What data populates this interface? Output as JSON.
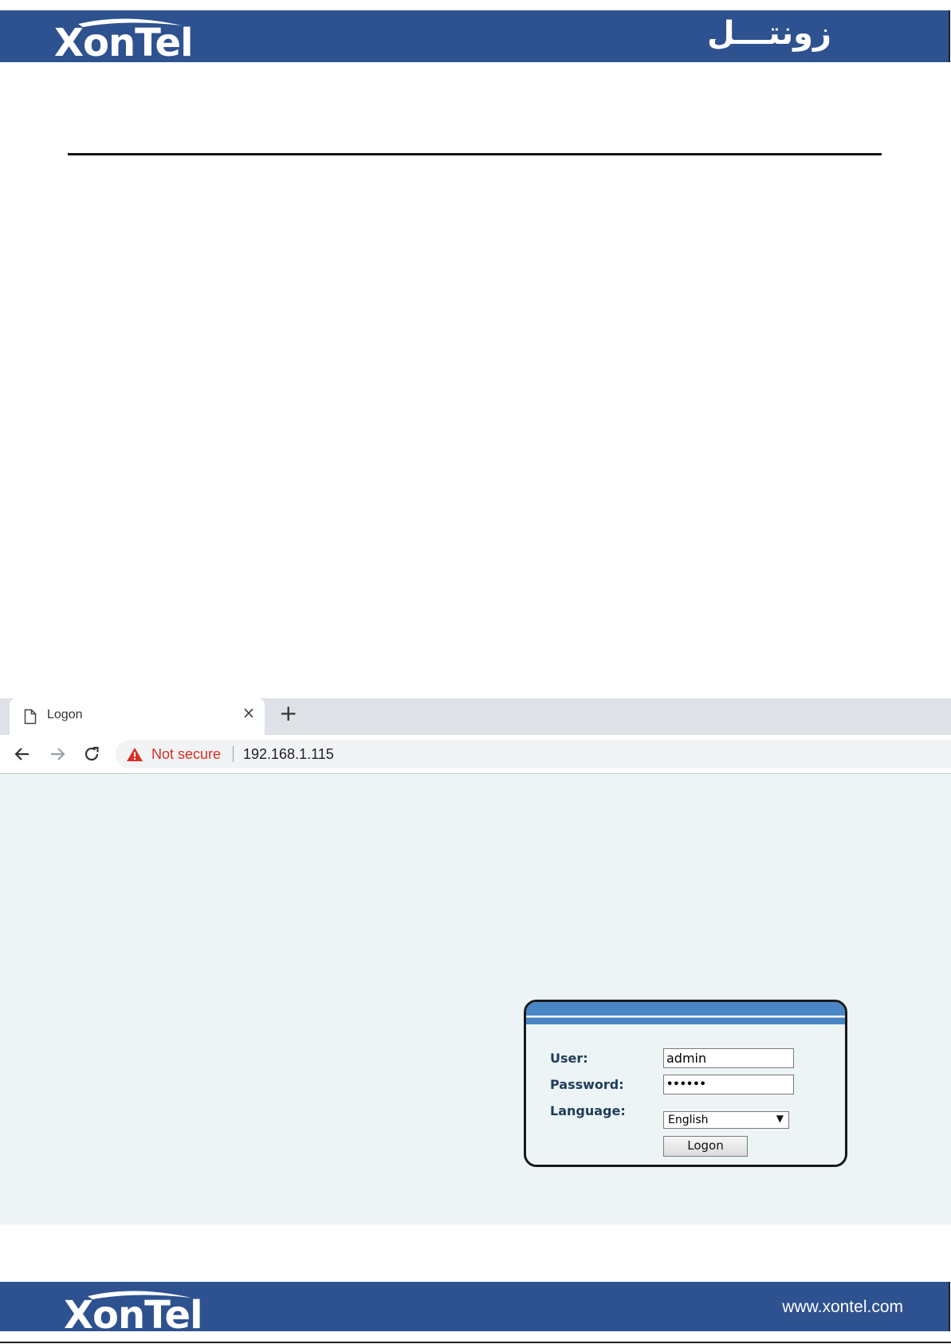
{
  "document": {
    "header": {
      "logo_text": "XonTel",
      "arabic_brand": "زونتـــل"
    },
    "footer": {
      "logo_text": "XonTel",
      "website": "www.xontel.com"
    }
  },
  "browser": {
    "tab": {
      "title": "Logon",
      "close_glyph": "×",
      "icon": "document-icon"
    },
    "new_tab_glyph": "+",
    "toolbar": {
      "back_icon": "back-arrow-icon",
      "forward_icon": "forward-arrow-icon",
      "reload_icon": "reload-icon",
      "security_label": "Not secure",
      "url": "192.168.1.115"
    }
  },
  "login_form": {
    "user_label": "User:",
    "user_value": "admin",
    "password_label": "Password:",
    "password_value": "••••••",
    "language_label": "Language:",
    "language_selected": "English",
    "submit_label": "Logon"
  },
  "colors": {
    "brand_band": "#2e5190",
    "page_background": "#ecf4f6",
    "panel_header": "#4a86c6",
    "not_secure_red": "#d93025",
    "label_text": "#1e3b5a"
  }
}
